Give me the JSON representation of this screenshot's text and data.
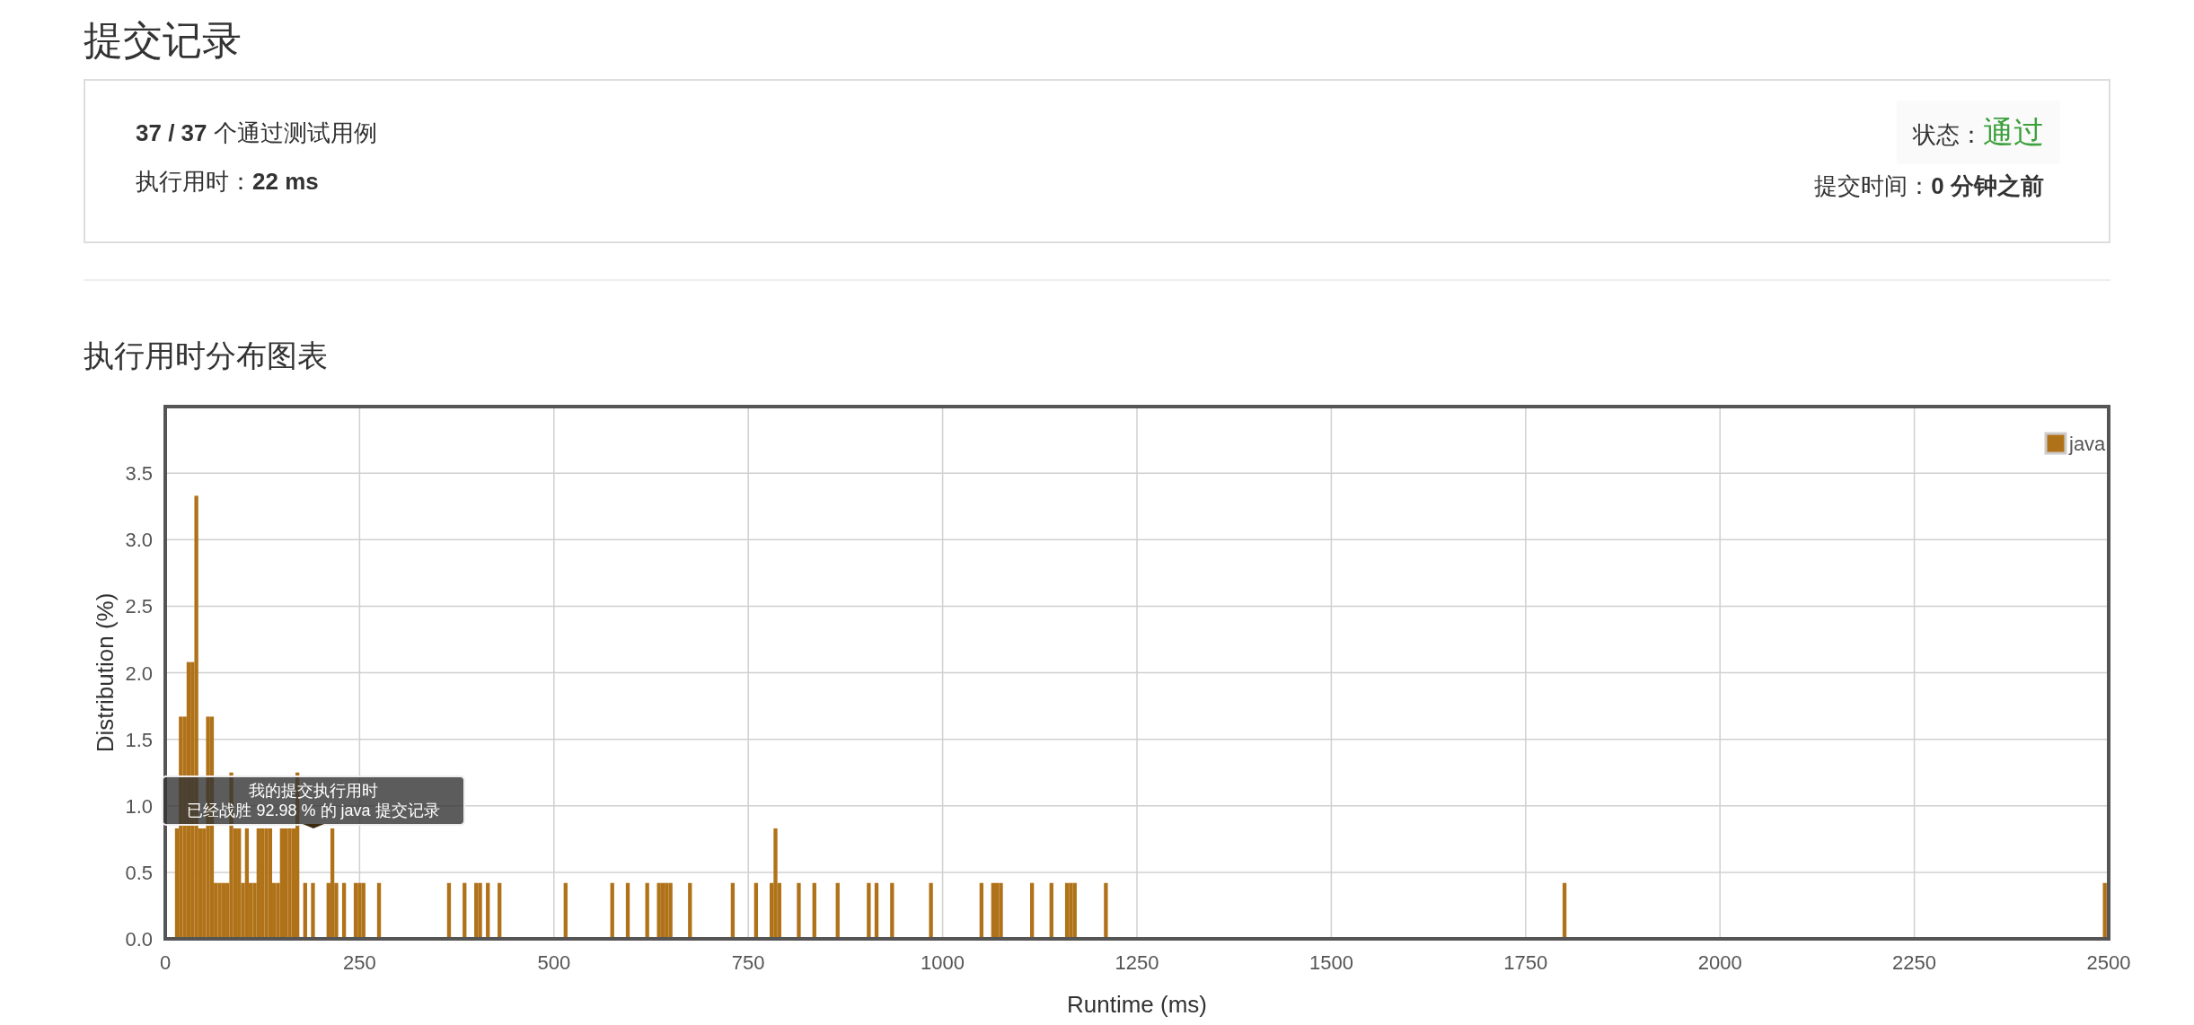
{
  "page_title": "提交记录",
  "summary": {
    "tests": "**37 / 37** 个通过测试用例",
    "runtime": "执行用时：**22 ms**",
    "status": {
      "label": "状态：",
      "value": "通过"
    },
    "submitted": "提交时间：**0 分钟之前**"
  },
  "chart": {
    "title": "执行用时分布图表",
    "chart_data": {
      "type": "bar",
      "xlabel": "Runtime (ms)",
      "ylabel": "Distribution (%)",
      "x": [
        15,
        20,
        25,
        30,
        35,
        40,
        45,
        50,
        55,
        60,
        65,
        70,
        75,
        80,
        85,
        90,
        95,
        100,
        105,
        110,
        115,
        120,
        125,
        130,
        135,
        140,
        145,
        150,
        155,
        160,
        165,
        170,
        180,
        190,
        210,
        215,
        220,
        230,
        245,
        250,
        255,
        275,
        365,
        385,
        400,
        405,
        415,
        430,
        515,
        575,
        595,
        620,
        635,
        640,
        645,
        650,
        675,
        730,
        760,
        780,
        785,
        790,
        815,
        835,
        865,
        905,
        915,
        935,
        985,
        1050,
        1065,
        1070,
        1075,
        1115,
        1140,
        1160,
        1165,
        1170,
        1210,
        1800,
        2495
      ],
      "series": [
        {
          "name": "java",
          "color": "#b07219",
          "values": [
            0.83,
            1.67,
            1.67,
            2.08,
            2.08,
            3.33,
            0.83,
            0.83,
            1.67,
            1.67,
            0.42,
            0.42,
            0.42,
            0.42,
            1.25,
            0.83,
            0.83,
            0.42,
            0.83,
            0.42,
            0.42,
            0.83,
            0.83,
            0.83,
            0.83,
            0.42,
            0.42,
            0.83,
            0.83,
            0.83,
            0.83,
            1.25,
            0.42,
            0.42,
            0.42,
            0.83,
            0.42,
            0.42,
            0.42,
            0.42,
            0.42,
            0.42,
            0.42,
            0.42,
            0.42,
            0.42,
            0.42,
            0.42,
            0.42,
            0.42,
            0.42,
            0.42,
            0.42,
            0.42,
            0.42,
            0.42,
            0.42,
            0.42,
            0.42,
            0.42,
            0.83,
            0.42,
            0.42,
            0.42,
            0.42,
            0.42,
            0.42,
            0.42,
            0.42,
            0.42,
            0.42,
            0.42,
            0.42,
            0.42,
            0.42,
            0.42,
            0.42,
            0.42,
            0.42,
            0.42,
            0.42
          ]
        }
      ],
      "xlim": [
        0,
        2500
      ],
      "ylim": [
        0,
        4
      ],
      "xticks": [
        0,
        250,
        500,
        750,
        1000,
        1250,
        1500,
        1750,
        2000,
        2250,
        2500
      ],
      "yticks": [
        {
          "value": 0,
          "label": "0.0"
        },
        {
          "value": 0.5,
          "label": "0.5"
        },
        {
          "value": 1,
          "label": "1.0"
        },
        {
          "value": 1.5,
          "label": "1.5"
        },
        {
          "value": 2,
          "label": "2.0"
        },
        {
          "value": 2.5,
          "label": "2.5"
        },
        {
          "value": 3,
          "label": "3.0"
        },
        {
          "value": 3.5,
          "label": "3.5"
        }
      ],
      "grid": true
    },
    "tooltip": {
      "lines": [
        "我的提交执行用时",
        "已经战胜 92.98 % 的 java 提交记录"
      ]
    }
  }
}
